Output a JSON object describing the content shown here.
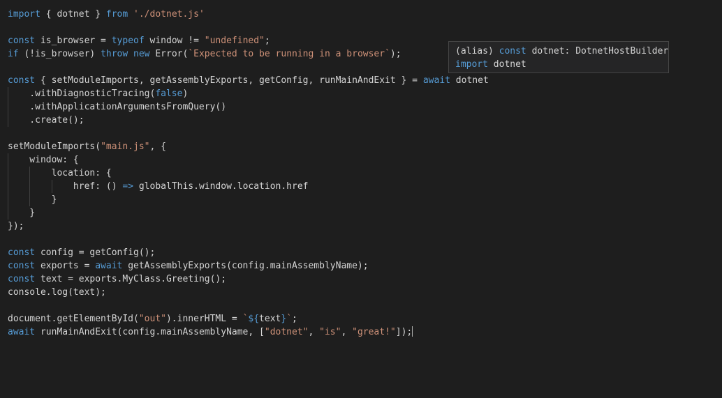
{
  "colors": {
    "background": "#1e1e1e",
    "keyword": "#569cd6",
    "string": "#ce9178",
    "function": "#dcdcaa",
    "variable": "#9cdcfe",
    "text": "#d4d4d4",
    "hover_background": "#252526",
    "hover_border": "#454545"
  },
  "editor": {
    "lines": [
      [
        [
          "kw",
          "import"
        ],
        [
          "plain",
          " { dotnet } "
        ],
        [
          "kw",
          "from"
        ],
        [
          "plain",
          " "
        ],
        [
          "str",
          "'./dotnet.js'"
        ]
      ],
      [],
      [
        [
          "kw",
          "const"
        ],
        [
          "plain",
          " is_browser = "
        ],
        [
          "kw",
          "typeof"
        ],
        [
          "plain",
          " window != "
        ],
        [
          "str",
          "\"undefined\""
        ],
        [
          "plain",
          ";"
        ]
      ],
      [
        [
          "kw",
          "if"
        ],
        [
          "plain",
          " (!is_browser) "
        ],
        [
          "kw",
          "throw"
        ],
        [
          "plain",
          " "
        ],
        [
          "kw",
          "new"
        ],
        [
          "plain",
          " Error("
        ],
        [
          "str",
          "`Expected to be running in a browser`"
        ],
        [
          "plain",
          ");"
        ]
      ],
      [],
      [
        [
          "kw",
          "const"
        ],
        [
          "plain",
          " { setModuleImports, getAssemblyExports, getConfig, runMainAndExit } = "
        ],
        [
          "kw",
          "await"
        ],
        [
          "plain",
          " dotnet"
        ]
      ],
      [
        [
          "plain",
          "    .withDiagnosticTracing("
        ],
        [
          "kw",
          "false"
        ],
        [
          "plain",
          ")"
        ]
      ],
      [
        [
          "plain",
          "    .withApplicationArgumentsFromQuery()"
        ]
      ],
      [
        [
          "plain",
          "    .create();"
        ]
      ],
      [],
      [
        [
          "plain",
          "setModuleImports("
        ],
        [
          "str",
          "\"main.js\""
        ],
        [
          "plain",
          ", {"
        ]
      ],
      [
        [
          "plain",
          "    window: {"
        ]
      ],
      [
        [
          "plain",
          "        location: {"
        ]
      ],
      [
        [
          "plain",
          "            href: () "
        ],
        [
          "kw",
          "=>"
        ],
        [
          "plain",
          " globalThis.window.location.href"
        ]
      ],
      [
        [
          "plain",
          "        }"
        ]
      ],
      [
        [
          "plain",
          "    }"
        ]
      ],
      [
        [
          "plain",
          "});"
        ]
      ],
      [],
      [
        [
          "kw",
          "const"
        ],
        [
          "plain",
          " config = getConfig();"
        ]
      ],
      [
        [
          "kw",
          "const"
        ],
        [
          "plain",
          " exports = "
        ],
        [
          "kw",
          "await"
        ],
        [
          "plain",
          " getAssemblyExports(config.mainAssemblyName);"
        ]
      ],
      [
        [
          "kw",
          "const"
        ],
        [
          "plain",
          " text = exports.MyClass.Greeting();"
        ]
      ],
      [
        [
          "plain",
          "console.log(text);"
        ]
      ],
      [],
      [
        [
          "plain",
          "document.getElementById("
        ],
        [
          "str",
          "\"out\""
        ],
        [
          "plain",
          ").innerHTML = "
        ],
        [
          "str",
          "`"
        ],
        [
          "kw",
          "${"
        ],
        [
          "plain",
          "text"
        ],
        [
          "kw",
          "}"
        ],
        [
          "str",
          "`"
        ],
        [
          "plain",
          ";"
        ]
      ],
      [
        [
          "kw",
          "await"
        ],
        [
          "plain",
          " runMainAndExit(config.mainAssemblyName, ["
        ],
        [
          "str",
          "\"dotnet\""
        ],
        [
          "plain",
          ", "
        ],
        [
          "str",
          "\"is\""
        ],
        [
          "plain",
          ", "
        ],
        [
          "str",
          "\"great!\""
        ],
        [
          "plain",
          "]);"
        ]
      ]
    ]
  },
  "hover": {
    "line1": [
      [
        "plain",
        "(alias) "
      ],
      [
        "kw",
        "const"
      ],
      [
        "plain",
        " dotnet: DotnetHostBuilder"
      ]
    ],
    "line2": [
      [
        "kw",
        "import"
      ],
      [
        "plain",
        " dotnet"
      ]
    ]
  }
}
